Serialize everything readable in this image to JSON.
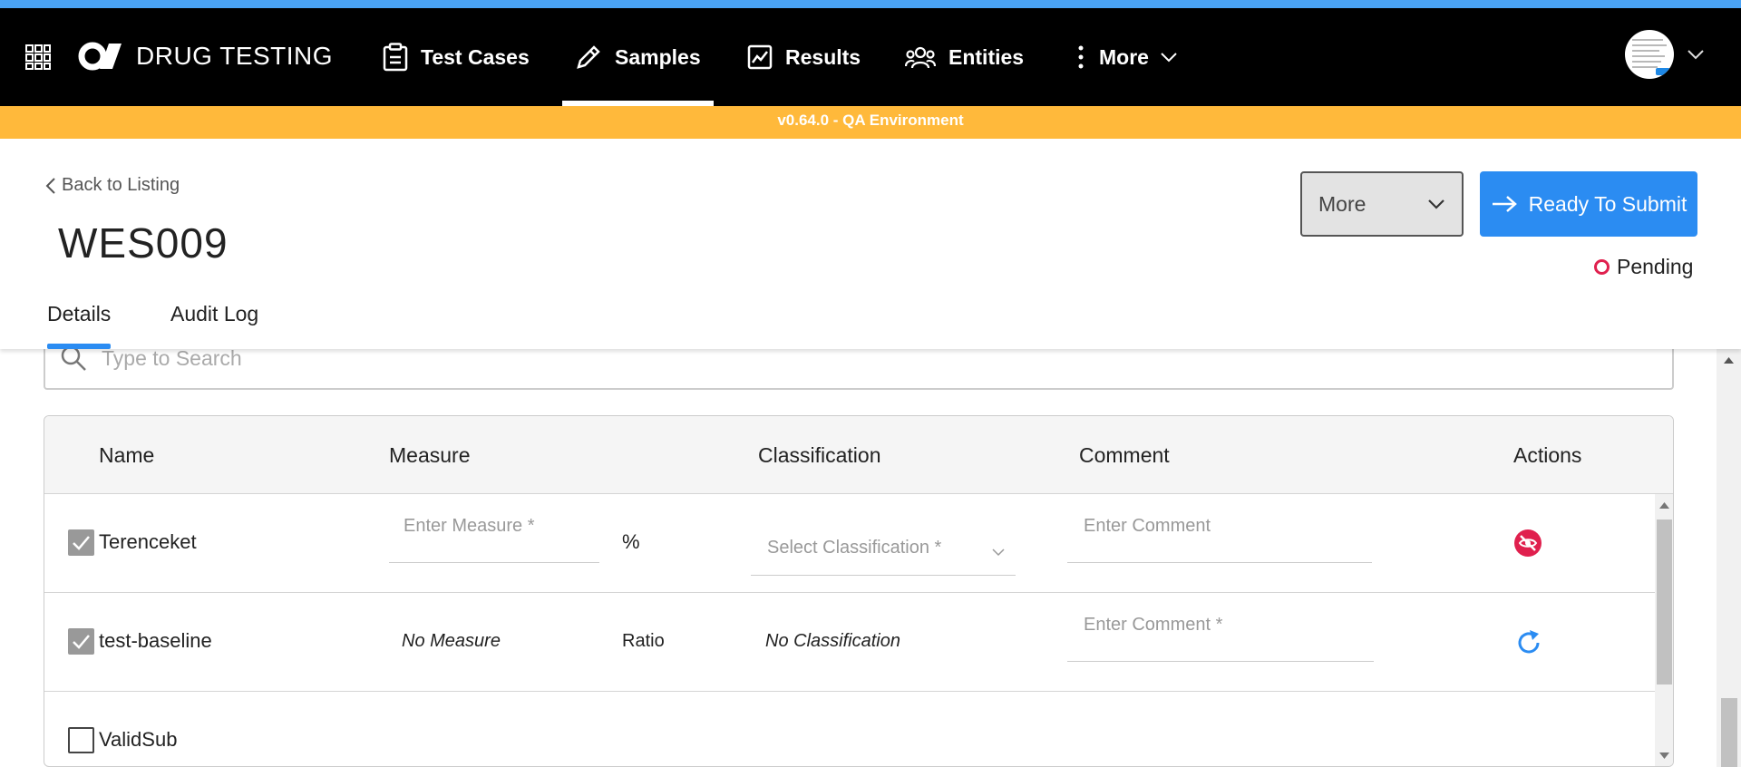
{
  "app": {
    "title": "DRUG TESTING",
    "environment": "v0.64.0 - QA Environment"
  },
  "nav": {
    "items": [
      {
        "label": "Test Cases",
        "icon": "clipboard-icon"
      },
      {
        "label": "Samples",
        "icon": "pen-icon",
        "active": true
      },
      {
        "label": "Results",
        "icon": "chart-line-icon"
      },
      {
        "label": "Entities",
        "icon": "users-icon"
      },
      {
        "label": "More",
        "icon": "kebab-icon"
      }
    ]
  },
  "header": {
    "back_label": "Back to Listing",
    "title": "WES009",
    "more_label": "More",
    "submit_label": "Ready To Submit",
    "status": "Pending"
  },
  "tabs": [
    {
      "label": "Details",
      "active": true
    },
    {
      "label": "Audit Log"
    }
  ],
  "search": {
    "placeholder": "Type to Search",
    "value": ""
  },
  "table": {
    "columns": [
      "Name",
      "Measure",
      "Classification",
      "Comment",
      "Actions"
    ],
    "rows": [
      {
        "checked": true,
        "name": "Terenceket",
        "measure_placeholder": "Enter Measure *",
        "unit": "%",
        "classification_placeholder": "Select Classification *",
        "comment_placeholder": "Enter Comment",
        "action_icon": "eye-off-icon"
      },
      {
        "checked": true,
        "name": "test-baseline",
        "measure": "No Measure",
        "unit": "Ratio",
        "classification": "No Classification",
        "comment_placeholder": "Enter Comment *",
        "action_icon": "refresh-icon"
      },
      {
        "checked": false,
        "name": "ValidSub"
      }
    ]
  },
  "colors": {
    "accent": "#2b8cf2",
    "banner": "#ffb93b",
    "status_pending": "#e0204e",
    "navbar": "#000000"
  }
}
